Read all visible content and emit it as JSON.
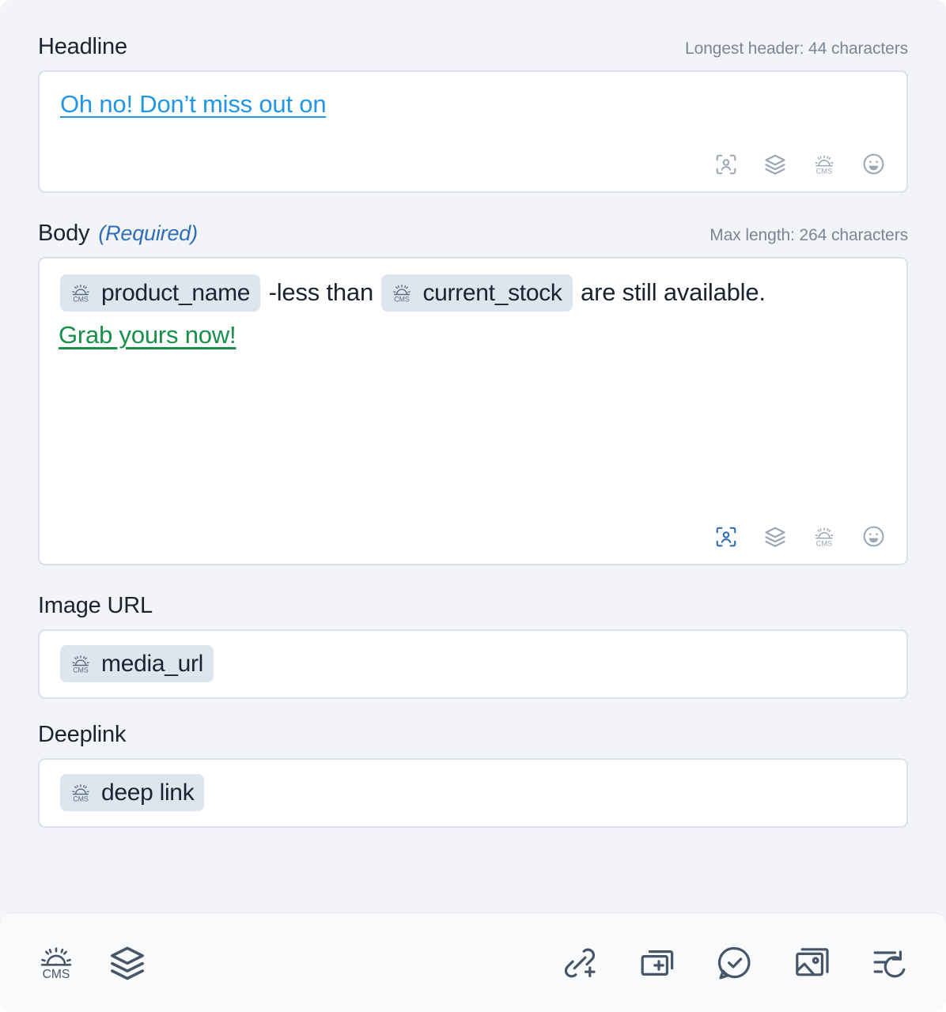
{
  "headline": {
    "label": "Headline",
    "hint": "Longest header: 44 characters",
    "value": "Oh no! Don’t miss out on",
    "toolbar": [
      {
        "name": "personalization-icon",
        "label": "Personalization",
        "active": false
      },
      {
        "name": "layers-icon",
        "label": "Layers",
        "active": false
      },
      {
        "name": "cms-icon",
        "label": "CMS",
        "active": false
      },
      {
        "name": "emoji-icon",
        "label": "Emoji",
        "active": false
      }
    ]
  },
  "body": {
    "label": "Body",
    "required_label": "(Required)",
    "hint": "Max length: 264 characters",
    "line1": {
      "token1": "product_name",
      "text1": " -less than ",
      "token2": "current_stock",
      "text2": " are still available."
    },
    "line2": "Grab yours now!",
    "toolbar": [
      {
        "name": "personalization-icon",
        "label": "Personalization",
        "active": true
      },
      {
        "name": "layers-icon",
        "label": "Layers",
        "active": false
      },
      {
        "name": "cms-icon",
        "label": "CMS",
        "active": false
      },
      {
        "name": "emoji-icon",
        "label": "Emoji",
        "active": false
      }
    ]
  },
  "image_url": {
    "label": "Image URL",
    "token": "media_url"
  },
  "deeplink": {
    "label": "Deeplink",
    "token": "deep link"
  },
  "bottom_bar": {
    "left": [
      {
        "name": "cms-icon",
        "label": "CMS"
      },
      {
        "name": "layers-icon",
        "label": "Layers"
      }
    ],
    "right": [
      {
        "name": "add-link-icon",
        "label": "Add link"
      },
      {
        "name": "add-card-icon",
        "label": "Add card"
      },
      {
        "name": "approve-chat-icon",
        "label": "Approve"
      },
      {
        "name": "media-image-icon",
        "label": "Media"
      },
      {
        "name": "revert-history-icon",
        "label": "Revert"
      }
    ]
  },
  "colors": {
    "page_bg": "#f2f4f8",
    "field_bg": "#ffffff",
    "field_border": "#dbe1ea",
    "chip_bg": "#dde5ef",
    "text_dark": "#1b2330",
    "hint_gray": "#7b8594",
    "link_blue": "#2296e3",
    "link_green": "#17904b",
    "required_blue": "#2f6fb5",
    "icon_gray": "#9aa6b5",
    "icon_active_blue": "#2f6fb5",
    "bar_icon": "#475569",
    "bar_bg": "#f8fafc"
  }
}
